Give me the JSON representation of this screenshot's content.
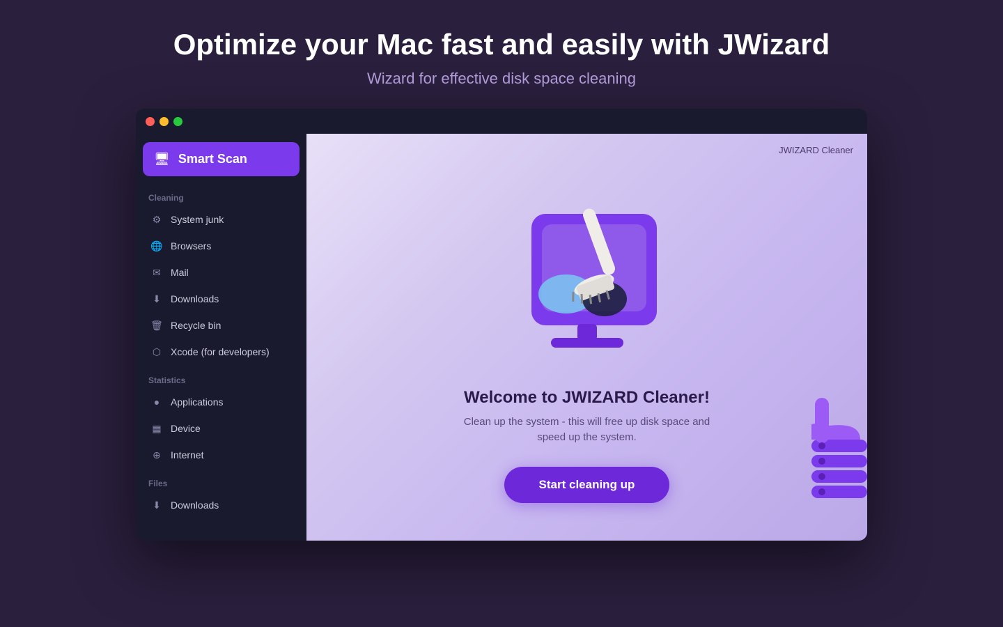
{
  "header": {
    "title": "Optimize your Mac fast and easily with JWizard",
    "subtitle": "Wizard for effective disk space cleaning"
  },
  "titlebar": {
    "traffic_lights": [
      "red",
      "yellow",
      "green"
    ]
  },
  "sidebar": {
    "smart_scan_label": "Smart Scan",
    "sections": [
      {
        "label": "Cleaning",
        "items": [
          {
            "icon": "⚙",
            "label": "System junk"
          },
          {
            "icon": "🌐",
            "label": "Browsers"
          },
          {
            "icon": "✉",
            "label": "Mail"
          },
          {
            "icon": "⬇",
            "label": "Downloads"
          },
          {
            "icon": "🗑",
            "label": "Recycle bin"
          },
          {
            "icon": "⬡",
            "label": "Xcode (for developers)"
          }
        ]
      },
      {
        "label": "Statistics",
        "items": [
          {
            "icon": "●",
            "label": "Applications"
          },
          {
            "icon": "▦",
            "label": "Device"
          },
          {
            "icon": "⊕",
            "label": "Internet"
          }
        ]
      },
      {
        "label": "Files",
        "items": [
          {
            "icon": "⬇",
            "label": "Downloads"
          }
        ]
      }
    ]
  },
  "main": {
    "app_name": "JWIZARD Cleaner",
    "welcome_title": "Welcome to JWIZARD Cleaner!",
    "welcome_subtitle": "Clean up the system - this will free up disk space and speed up the system.",
    "start_button_label": "Start cleaning up"
  }
}
